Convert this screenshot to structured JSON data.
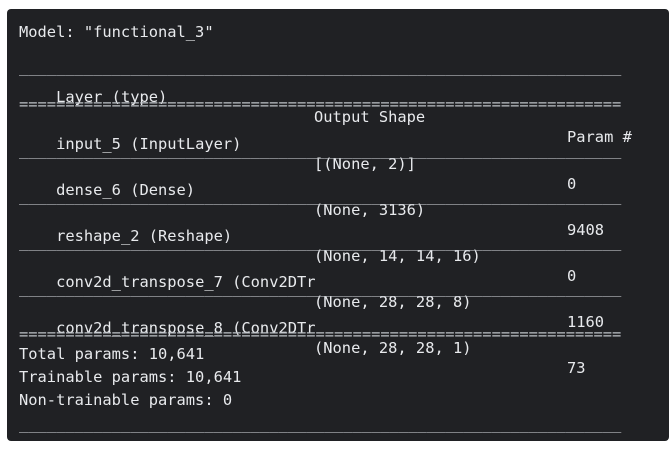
{
  "model_line": "Model: \"functional_3\"",
  "rule_dash": "_________________________________________________________________",
  "rule_equal": "=================================================================",
  "headers": {
    "layer": "Layer (type)",
    "shape": "Output Shape",
    "param": "Param #"
  },
  "rows": [
    {
      "layer": "input_5 (InputLayer)",
      "shape": "[(None, 2)]",
      "param": "0"
    },
    {
      "layer": "dense_6 (Dense)",
      "shape": "(None, 3136)",
      "param": "9408"
    },
    {
      "layer": "reshape_2 (Reshape)",
      "shape": "(None, 14, 14, 16)",
      "param": "0"
    },
    {
      "layer": "conv2d_transpose_7 (Conv2DTr",
      "shape": "(None, 28, 28, 8)",
      "param": "1160"
    },
    {
      "layer": "conv2d_transpose_8 (Conv2DTr",
      "shape": "(None, 28, 28, 1)",
      "param": "73"
    }
  ],
  "totals": {
    "total": "Total params: 10,641",
    "trainable": "Trainable params: 10,641",
    "non_trainable": "Non-trainable params: 0"
  },
  "colors": {
    "background": "#202124",
    "text": "#e8eaed"
  }
}
